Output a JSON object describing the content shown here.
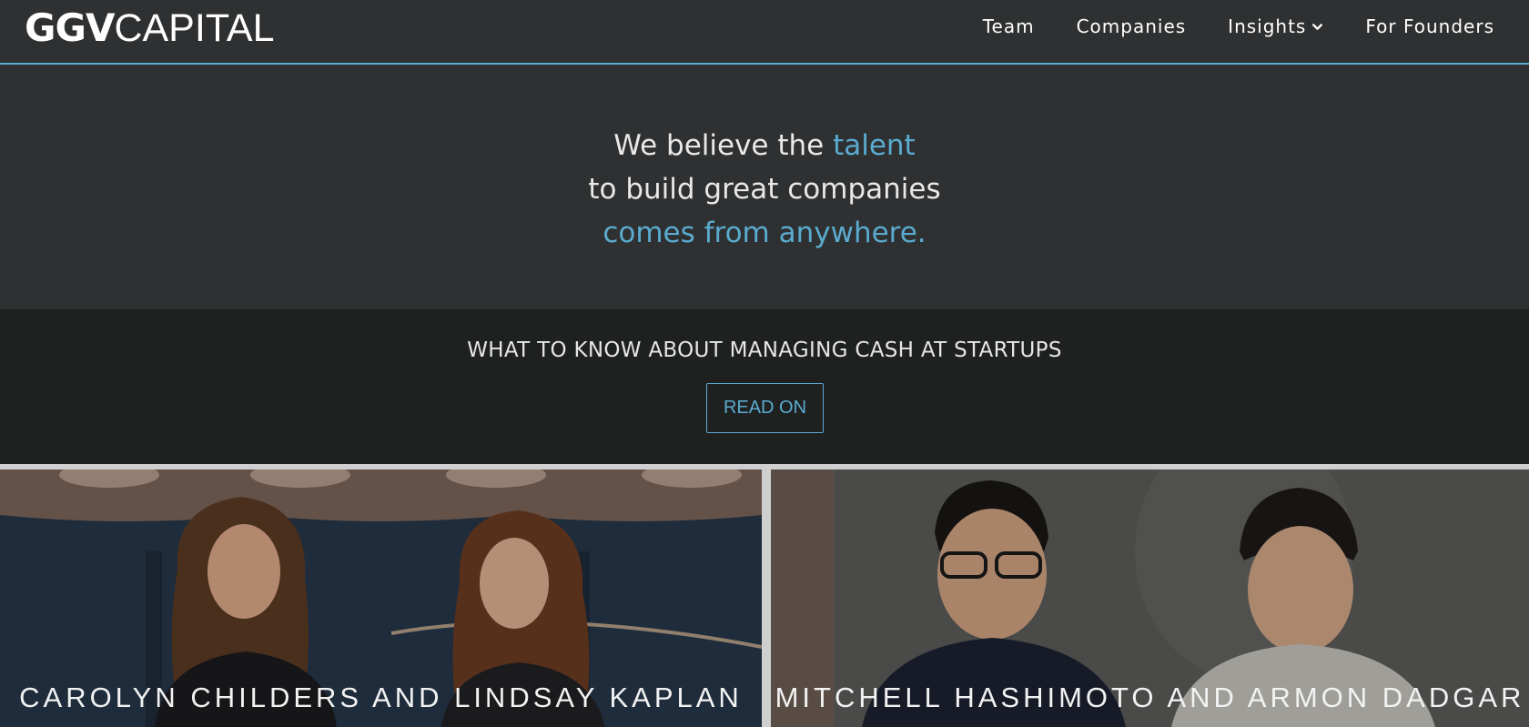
{
  "brand": {
    "logo_bold": "GGV",
    "logo_light": "CAPITAL"
  },
  "nav": {
    "items": [
      {
        "label": "Team"
      },
      {
        "label": "Companies"
      },
      {
        "label": "Insights"
      },
      {
        "label": "For Founders"
      }
    ]
  },
  "hero": {
    "line1_prefix": "We believe the ",
    "line1_accent": "talent",
    "line2": "to build great companies",
    "line3": "comes from anywhere."
  },
  "promo": {
    "title": "WHAT TO KNOW ABOUT MANAGING CASH AT STARTUPS",
    "button_label": "READ ON"
  },
  "cards": [
    {
      "caption": "CAROLYN CHILDERS AND LINDSAY KAPLAN"
    },
    {
      "caption": "MITCHELL HASHIMOTO AND ARMON DADGAR"
    }
  ],
  "colors": {
    "background": "#2e3031",
    "promo_background": "#1f2121",
    "accent": "#5aabcf",
    "text": "#ffffff"
  }
}
